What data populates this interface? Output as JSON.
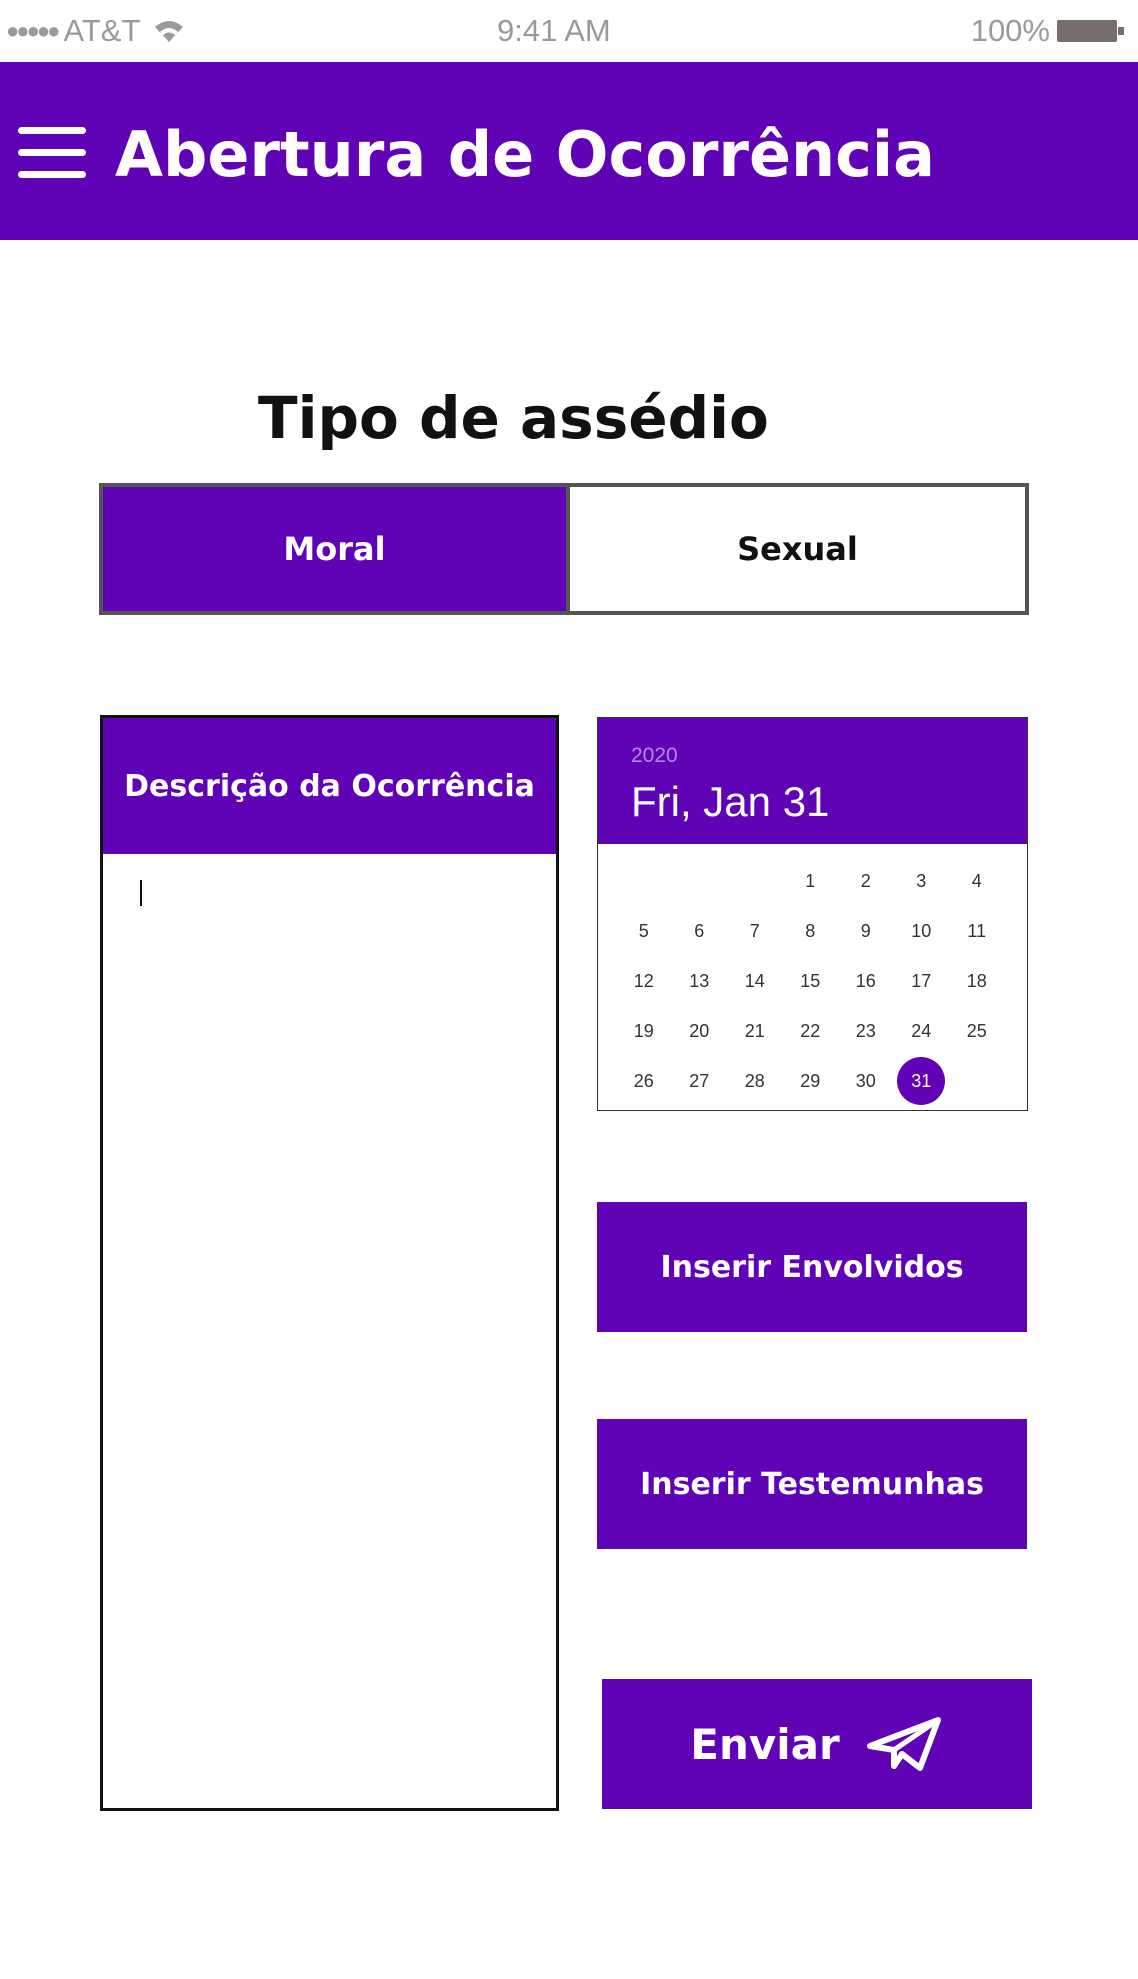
{
  "status_bar": {
    "signal": "●●●●●",
    "carrier": "AT&T",
    "wifi_icon": "wifi-icon",
    "time": "9:41 AM",
    "battery": "100%",
    "battery_icon": "battery-icon"
  },
  "app_bar": {
    "menu_icon": "hamburger-menu-icon",
    "title": "Abertura de Ocorrência"
  },
  "harassment_type": {
    "title": "Tipo de assédio",
    "options": [
      {
        "label": "Moral",
        "selected": true
      },
      {
        "label": "Sexual",
        "selected": false
      }
    ]
  },
  "description": {
    "header": "Descrição da Ocorrência",
    "value": ""
  },
  "calendar": {
    "year": "2020",
    "selected_label": "Fri, Jan 31",
    "selected_day": 31,
    "leading_blanks": 3,
    "days": [
      1,
      2,
      3,
      4,
      5,
      6,
      7,
      8,
      9,
      10,
      11,
      12,
      13,
      14,
      15,
      16,
      17,
      18,
      19,
      20,
      21,
      22,
      23,
      24,
      25,
      26,
      27,
      28,
      29,
      30,
      31
    ]
  },
  "buttons": {
    "envolvidos": "Inserir Envolvidos",
    "testemunhas": "Inserir Testemunhas",
    "enviar": "Enviar",
    "send_icon": "paper-plane-send-icon"
  },
  "colors": {
    "primary": "#6003b7",
    "on_primary": "#ffffff",
    "border": "#555555"
  }
}
